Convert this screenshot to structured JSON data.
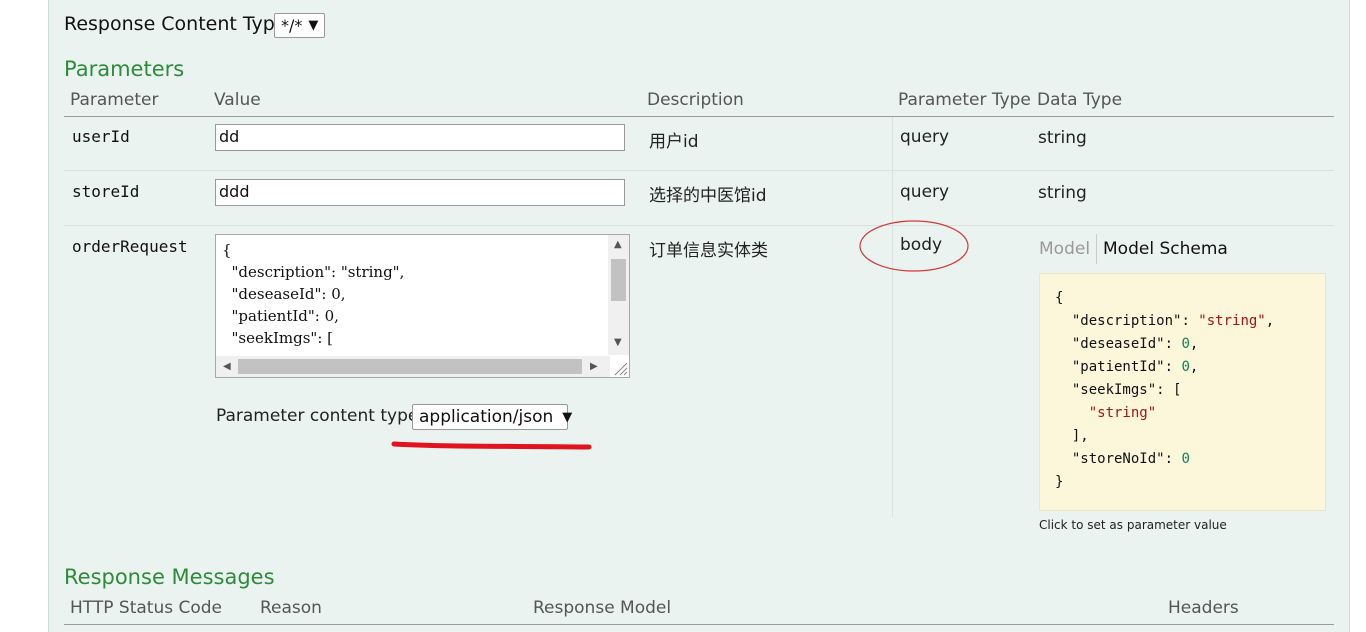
{
  "response_content_type": {
    "label": "Response Content Type",
    "value": "*/*"
  },
  "parameters": {
    "title": "Parameters",
    "headers": [
      "Parameter",
      "Value",
      "Description",
      "Parameter Type",
      "Data Type"
    ],
    "rows": [
      {
        "name": "userId",
        "value": "dd",
        "description": "用户id",
        "param_type": "query",
        "data_type": "string"
      },
      {
        "name": "storeId",
        "value": "ddd",
        "description": "选择的中医馆id",
        "param_type": "query",
        "data_type": "string"
      },
      {
        "name": "orderRequest",
        "description": "订单信息实体类",
        "param_type": "body",
        "textarea_lines": [
          "{",
          "  \"description\": \"string\",",
          "  \"deseaseId\": 0,",
          "  \"patientId\": 0,",
          "  \"seekImgs\": ["
        ],
        "content_type_label": "Parameter content type:",
        "content_type_value": "application/json"
      }
    ]
  },
  "model_tabs": {
    "model": "Model",
    "model_schema": "Model Schema"
  },
  "schema": {
    "open": "{",
    "description_key": "\"description\"",
    "description_val": "\"string\"",
    "deseaseId_key": "\"deseaseId\"",
    "deseaseId_val": "0",
    "patientId_key": "\"patientId\"",
    "patientId_val": "0",
    "seekImgs_key": "\"seekImgs\"",
    "seekImgs_open": "[",
    "seekImgs_item": "\"string\"",
    "seekImgs_close": "],",
    "storeNoId_key": "\"storeNoId\"",
    "storeNoId_val": "0",
    "close": "}"
  },
  "click_hint": "Click to set as parameter value",
  "response_messages": {
    "title": "Response Messages",
    "headers": [
      "HTTP Status Code",
      "Reason",
      "Response Model",
      "Headers"
    ]
  },
  "annotation_colors": {
    "ellipse": "#d23a3a",
    "underline": "#e0141e"
  }
}
